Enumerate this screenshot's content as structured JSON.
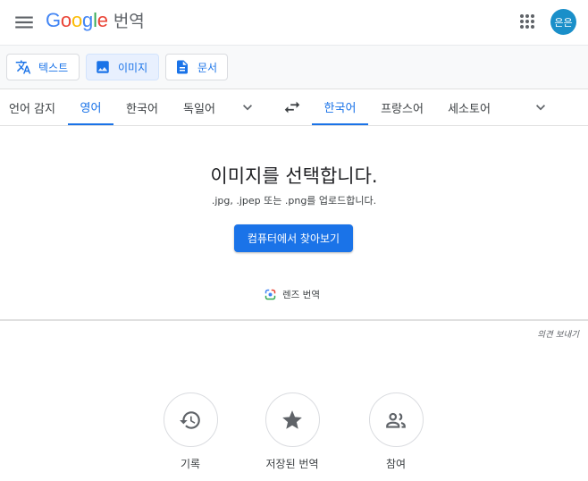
{
  "header": {
    "logo_letters": [
      {
        "ch": "G",
        "color": "#4285F4"
      },
      {
        "ch": "o",
        "color": "#EA4335"
      },
      {
        "ch": "o",
        "color": "#FBBC05"
      },
      {
        "ch": "g",
        "color": "#4285F4"
      },
      {
        "ch": "l",
        "color": "#34A853"
      },
      {
        "ch": "e",
        "color": "#EA4335"
      }
    ],
    "product_name": "번역",
    "avatar_text": "은은",
    "menu_icon": "hamburger-menu-icon",
    "apps_icon": "apps-grid-icon"
  },
  "toolbar": {
    "modes": [
      {
        "label": "텍스트",
        "icon": "translate-icon",
        "active": false
      },
      {
        "label": "이미지",
        "icon": "image-icon",
        "active": true
      },
      {
        "label": "문서",
        "icon": "document-icon",
        "active": false
      }
    ]
  },
  "languages": {
    "source": [
      {
        "label": "언어 감지",
        "active": false
      },
      {
        "label": "영어",
        "active": true
      },
      {
        "label": "한국어",
        "active": false
      },
      {
        "label": "독일어",
        "active": false
      }
    ],
    "target": [
      {
        "label": "한국어",
        "active": true
      },
      {
        "label": "프랑스어",
        "active": false
      },
      {
        "label": "세소토어",
        "active": false
      }
    ],
    "swap_icon": "swap-arrows-icon"
  },
  "upload": {
    "title": "이미지를 선택합니다.",
    "subtitle": ".jpg, .jpep 또는 .png를 업로드합니다.",
    "browse_label": "컴퓨터에서 찾아보기",
    "lens_label": "렌즈 번역"
  },
  "feedback_label": "의견 보내기",
  "bottom": [
    {
      "label": "기록",
      "icon": "history-icon"
    },
    {
      "label": "저장된 번역",
      "icon": "star-icon"
    },
    {
      "label": "참여",
      "icon": "people-icon"
    }
  ],
  "colors": {
    "accent": "#1a73e8",
    "avatar_bg": "#1a8fc9"
  }
}
